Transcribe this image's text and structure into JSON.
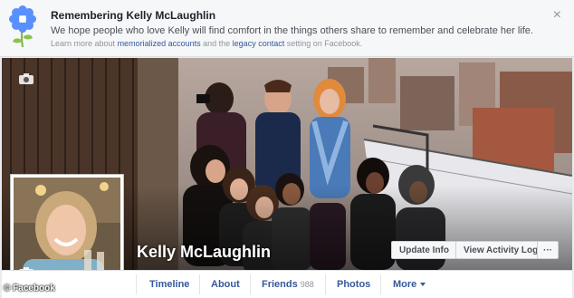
{
  "banner": {
    "title": "Remembering Kelly McLaughlin",
    "message": "We hope people who love Kelly will find comfort in the things others share to remember and celebrate her life.",
    "sub_prefix": "Learn more about",
    "link1": "memorialized accounts",
    "sub_middle": "and the",
    "link2": "legacy contact",
    "sub_suffix": "setting on Facebook.",
    "close_icon": "×"
  },
  "profile": {
    "name": "Kelly McLaughlin"
  },
  "actions": {
    "update_info": "Update Info",
    "activity_log": "View Activity Log",
    "more": "···"
  },
  "tabs": {
    "timeline": "Timeline",
    "about": "About",
    "friends": "Friends",
    "friends_count": "988",
    "photos": "Photos",
    "more": "More"
  },
  "watermark": "© Facebook",
  "colors": {
    "link": "#365899",
    "flower": "#5890ff"
  }
}
